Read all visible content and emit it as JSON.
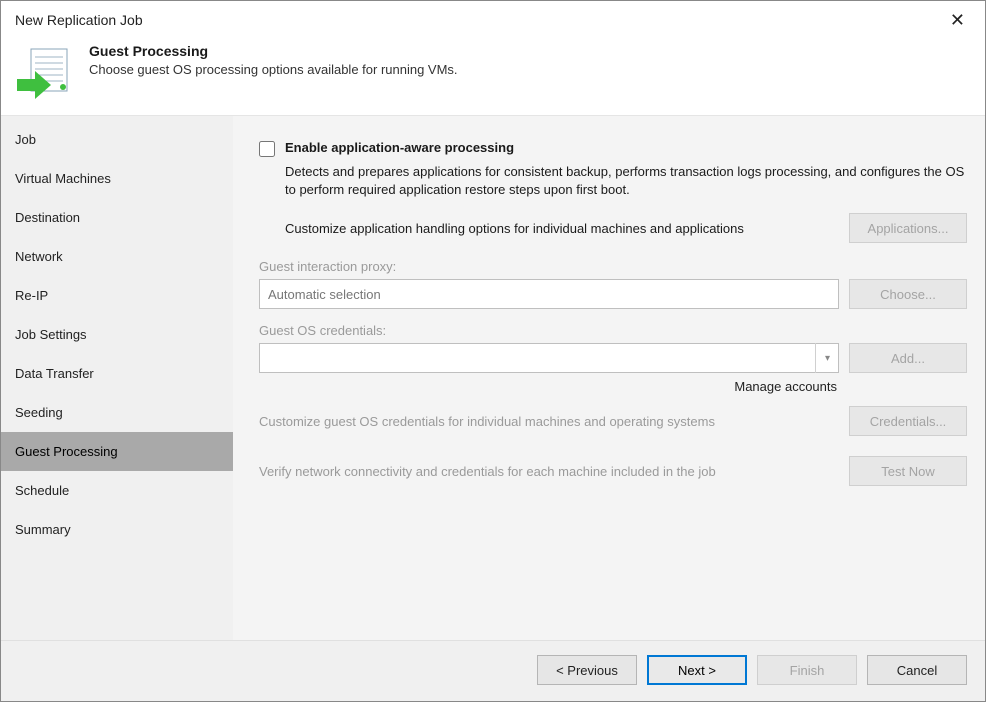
{
  "window": {
    "title": "New Replication Job"
  },
  "header": {
    "title": "Guest Processing",
    "subtitle": "Choose guest OS processing options available for running VMs."
  },
  "sidebar": {
    "items": [
      {
        "label": "Job"
      },
      {
        "label": "Virtual Machines"
      },
      {
        "label": "Destination"
      },
      {
        "label": "Network"
      },
      {
        "label": "Re-IP"
      },
      {
        "label": "Job Settings"
      },
      {
        "label": "Data Transfer"
      },
      {
        "label": "Seeding"
      },
      {
        "label": "Guest Processing"
      },
      {
        "label": "Schedule"
      },
      {
        "label": "Summary"
      }
    ],
    "selected_index": 8
  },
  "content": {
    "enable_checkbox_label": "Enable application-aware processing",
    "enable_checkbox_checked": false,
    "enable_desc": "Detects and prepares applications for consistent backup, performs transaction logs processing, and configures the OS to perform required application restore steps upon first boot.",
    "customize_app_text": "Customize application handling options for individual machines and applications",
    "applications_btn": "Applications...",
    "proxy_label": "Guest interaction proxy:",
    "proxy_value": "Automatic selection",
    "choose_btn": "Choose...",
    "creds_label": "Guest OS credentials:",
    "creds_value": "",
    "add_btn": "Add...",
    "manage_accounts": "Manage accounts",
    "customize_creds_text": "Customize guest OS credentials for individual machines and operating systems",
    "credentials_btn": "Credentials...",
    "verify_text": "Verify network connectivity and credentials for each machine included in the job",
    "test_now_btn": "Test Now"
  },
  "footer": {
    "previous": "< Previous",
    "next": "Next >",
    "finish": "Finish",
    "cancel": "Cancel"
  }
}
